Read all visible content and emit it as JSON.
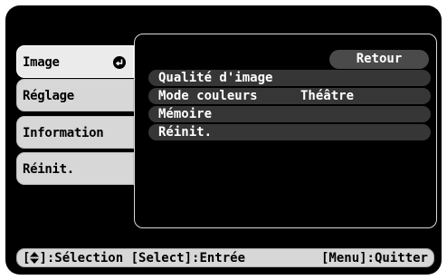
{
  "menu": {
    "tabs": [
      {
        "label": "Image",
        "active": true,
        "icon": "enter-icon"
      },
      {
        "label": "Réglage",
        "active": false
      },
      {
        "label": "Information",
        "active": false
      },
      {
        "label": "Réinit.",
        "active": false
      }
    ]
  },
  "submenu": {
    "back_label": "Retour",
    "options": [
      {
        "name": "Qualité d'image",
        "value": ""
      },
      {
        "name": "Mode couleurs",
        "value": "Théâtre"
      },
      {
        "name": "Mémoire",
        "value": ""
      },
      {
        "name": "Réinit.",
        "value": ""
      }
    ]
  },
  "help": {
    "bracket_open": "[",
    "selection_hint": "]:Sélection [Select]:Entrée",
    "quit_hint": "[Menu]:Quitter",
    "updown_icon": "up-down-arrow-icon"
  }
}
